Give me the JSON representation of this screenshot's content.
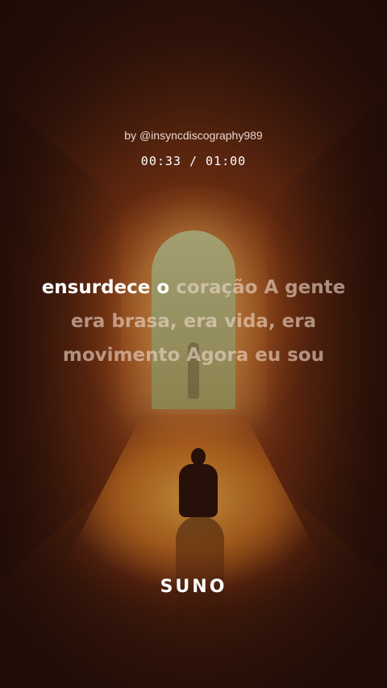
{
  "header": {
    "author": "by @insyncdiscography989",
    "time": "00:33 / 01:00"
  },
  "lyrics": {
    "sung": "ensurdece o",
    "upcoming_line1": "coração A gente",
    "line2": "era brasa, era vida, era",
    "line3": "movimento Agora eu sou"
  },
  "brand": {
    "logo": "SUNO"
  },
  "colors": {
    "accent_orange": "#b8561f",
    "text_active": "#ffffff",
    "text_inactive": "#eed7c8"
  }
}
